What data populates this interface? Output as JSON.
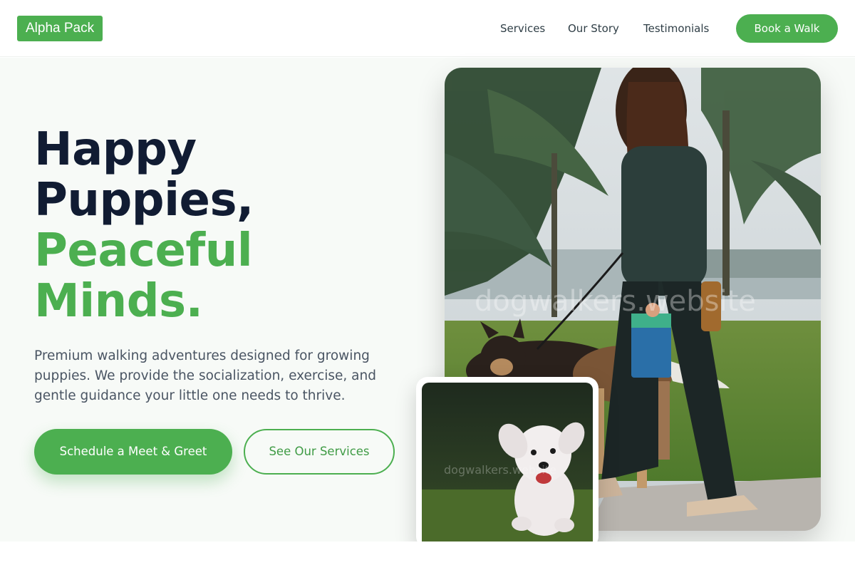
{
  "brand": {
    "logo_text": "Alpha Pack",
    "accent": "#4caf50"
  },
  "nav": {
    "items": [
      {
        "label": "Services"
      },
      {
        "label": "Our Story"
      },
      {
        "label": "Testimonials"
      }
    ],
    "cta_label": "Book a Walk"
  },
  "hero": {
    "headline": {
      "line1": "Happy",
      "line2": "Puppies,",
      "line3": "Peaceful",
      "line4": "Minds."
    },
    "description": "Premium walking adventures designed for growing puppies. We provide the socialization, exercise, and gentle guidance your little one needs to thrive.",
    "primary_button": "Schedule a Meet & Greet",
    "secondary_button": "See Our Services"
  },
  "images": {
    "main_watermark": "dogwalkers.website",
    "inset_watermark": "dogwalkers.website"
  },
  "colors": {
    "heading_dark": "#111c33",
    "heading_green": "#4caf50",
    "body_text": "#4a5563",
    "hero_bg": "#f7faf7"
  }
}
